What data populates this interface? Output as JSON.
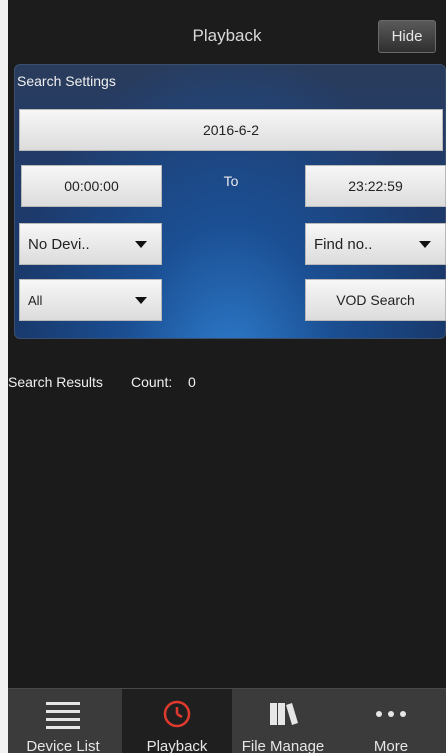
{
  "header": {
    "title": "Playback",
    "hide_label": "Hide"
  },
  "search_settings": {
    "title": "Search Settings",
    "date": "2016-6-2",
    "start_time": "00:00:00",
    "to_label": "To",
    "end_time": "23:22:59",
    "device_select": "No Devi..",
    "find_select": "Find no..",
    "type_select": "All",
    "vod_search_label": "VOD Search"
  },
  "results": {
    "label": "Search Results",
    "count_label": "Count:",
    "count_value": "0"
  },
  "nav": {
    "items": [
      {
        "label": "Device List",
        "icon": "list-icon"
      },
      {
        "label": "Playback",
        "icon": "clock-icon"
      },
      {
        "label": "File Manage",
        "icon": "files-icon"
      },
      {
        "label": "More",
        "icon": "more-icon"
      }
    ],
    "active_color": "#e03a2f"
  }
}
